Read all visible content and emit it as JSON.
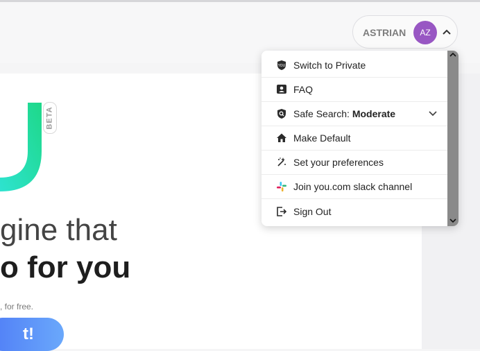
{
  "account": {
    "name": "ASTRIAN",
    "initials": "AZ"
  },
  "hero": {
    "beta": "BETA",
    "line1": "gine that",
    "line2": "o for you",
    "sub": ", for free.",
    "cta": "t!"
  },
  "menu": {
    "items": [
      {
        "label": "Switch to Private",
        "icon": "you-shield-icon"
      },
      {
        "label": "FAQ",
        "icon": "faq-icon"
      },
      {
        "label": "Safe Search: ",
        "value": "Moderate",
        "icon": "safe-search-shield-icon"
      },
      {
        "label": "Make Default",
        "icon": "home-icon"
      },
      {
        "label": "Set your preferences",
        "icon": "sparkles-icon"
      },
      {
        "label": "Join you.com slack channel",
        "icon": "slack-icon"
      },
      {
        "label": "Sign Out",
        "icon": "sign-out-icon"
      }
    ]
  },
  "colors": {
    "avatar": "#9857c3",
    "logo_gradient_start": "#2ee3d0",
    "logo_gradient_end": "#1ed889",
    "cta_start": "#4f7cf6",
    "cta_end": "#6aa8fb",
    "scrollbar": "#8a8a8a"
  }
}
